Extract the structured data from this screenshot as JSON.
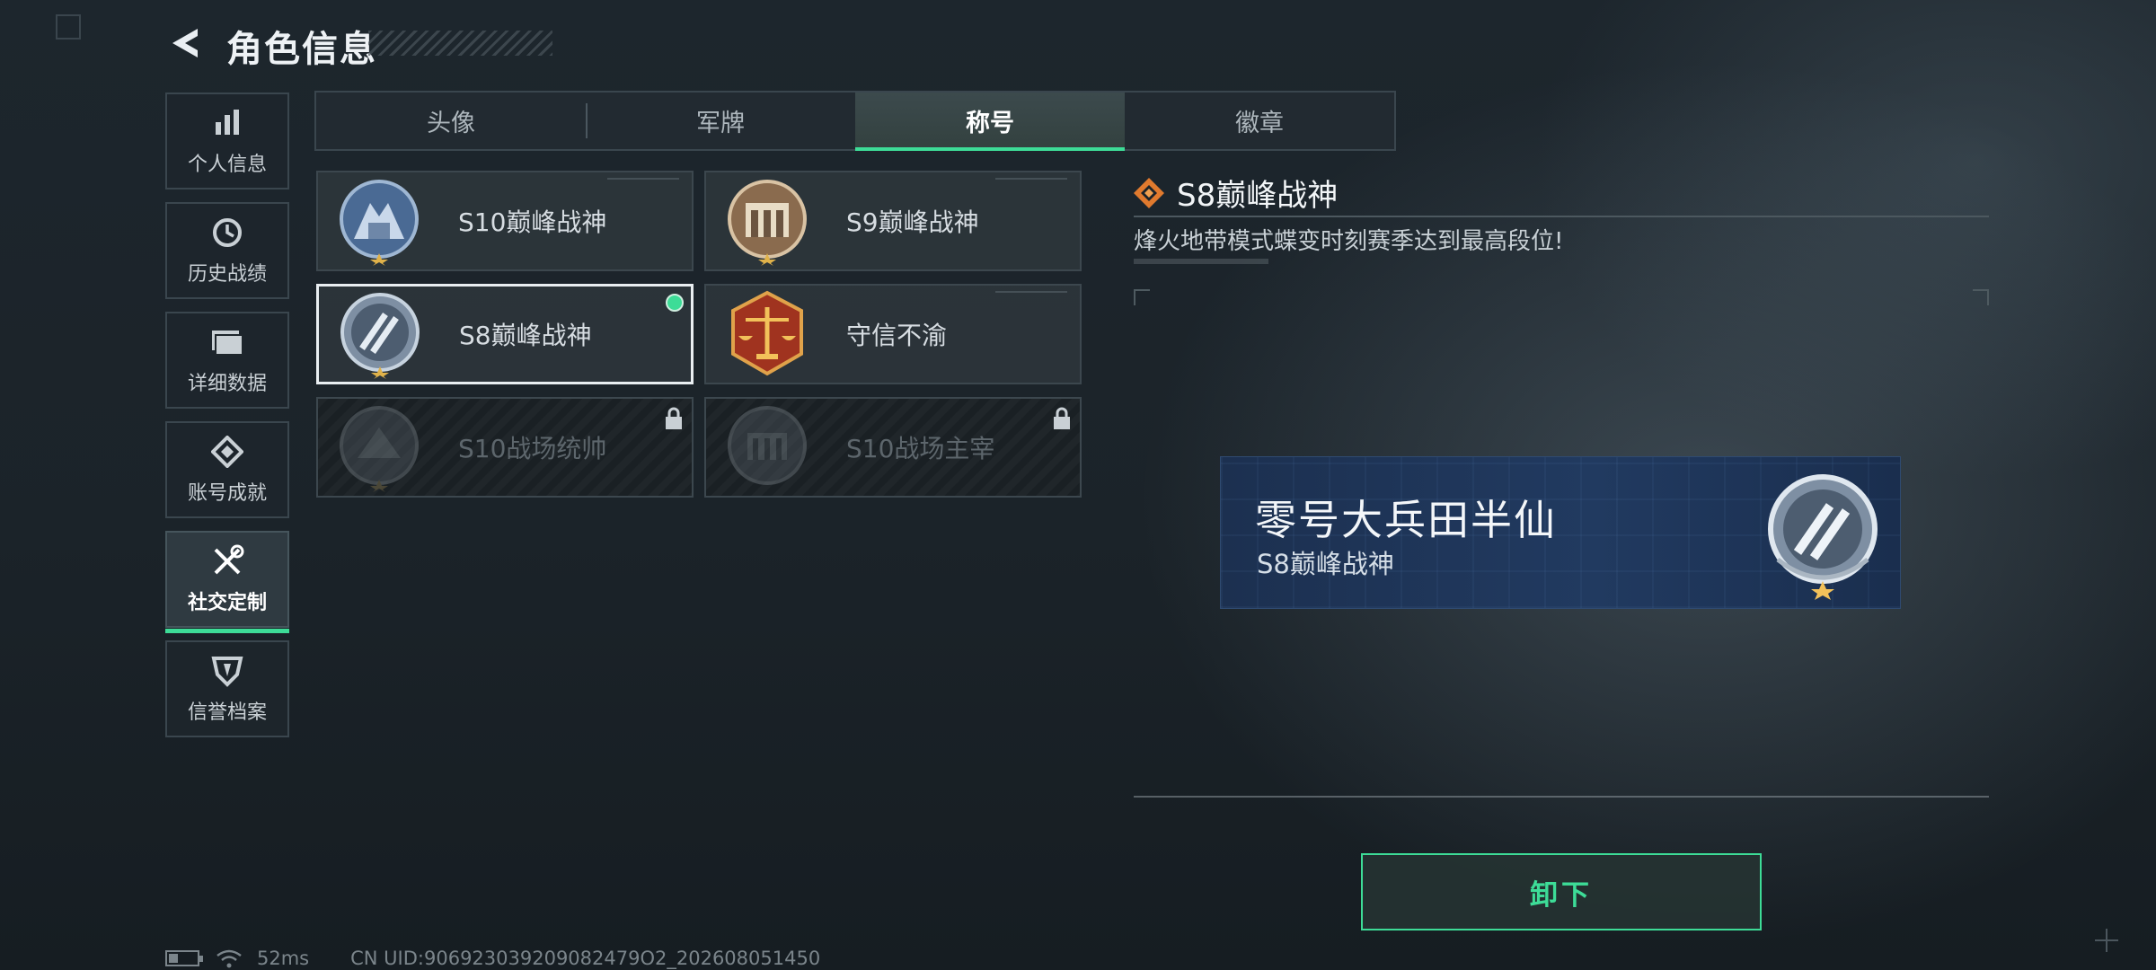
{
  "header": {
    "title": "角色信息"
  },
  "sidebar": {
    "items": [
      {
        "label": "个人信息",
        "icon": "bar-chart-icon"
      },
      {
        "label": "历史战绩",
        "icon": "history-clock-icon"
      },
      {
        "label": "详细数据",
        "icon": "folder-icon"
      },
      {
        "label": "账号成就",
        "icon": "achievement-icon"
      },
      {
        "label": "社交定制",
        "icon": "tools-icon",
        "active": true
      },
      {
        "label": "信誉档案",
        "icon": "reputation-shield-icon"
      }
    ]
  },
  "tabs": [
    {
      "label": "头像"
    },
    {
      "label": "军牌"
    },
    {
      "label": "称号",
      "active": true
    },
    {
      "label": "徽章"
    }
  ],
  "titles": [
    {
      "name": "S10巅峰战神",
      "state": "owned",
      "emblem": "s10-peak-emblem-icon"
    },
    {
      "name": "S9巅峰战神",
      "state": "owned",
      "emblem": "s9-peak-emblem-icon"
    },
    {
      "name": "S8巅峰战神",
      "state": "selected-equipped",
      "emblem": "s8-peak-emblem-icon"
    },
    {
      "name": "守信不渝",
      "state": "owned",
      "emblem": "scales-emblem-icon"
    },
    {
      "name": "S10战场统帅",
      "state": "locked",
      "emblem": "s10-commander-emblem-icon"
    },
    {
      "name": "S10战场主宰",
      "state": "locked",
      "emblem": "s10-dominator-emblem-icon"
    }
  ],
  "detail": {
    "title": "S8巅峰战神",
    "description": "烽火地带模式蝶变时刻赛季达到最高段位!"
  },
  "nameplate": {
    "player_name": "零号大兵田半仙",
    "title": "S8巅峰战神"
  },
  "actions": {
    "unequip_label": "卸下"
  },
  "status_bar": {
    "ping": "52ms",
    "uid": "CN UID:906923039209082479O2_202608051450"
  },
  "colors": {
    "accent": "#3ddc97",
    "background": "#1b2329",
    "plate": "#213a60"
  }
}
